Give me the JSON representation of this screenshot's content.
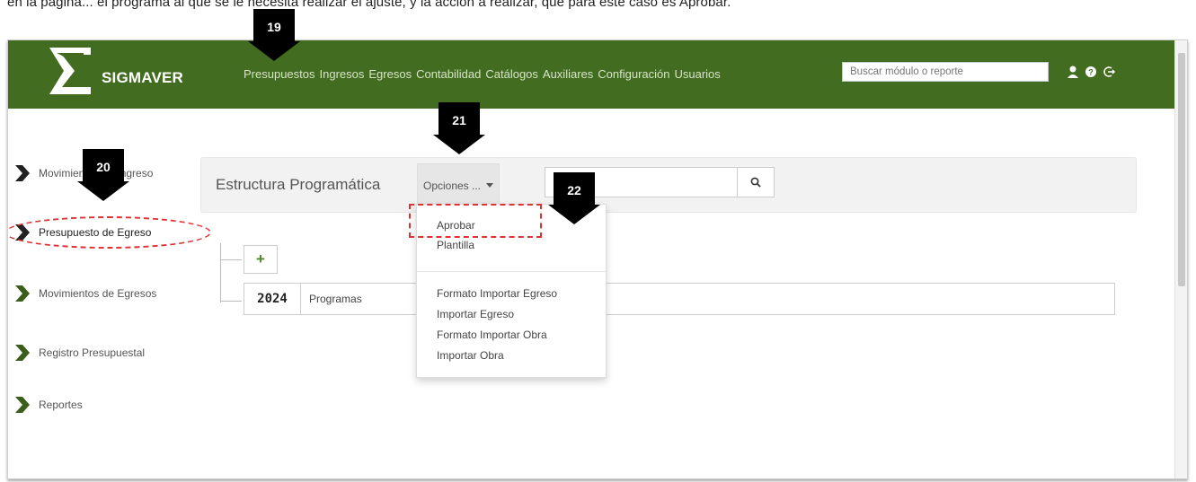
{
  "caption": {
    "text": "en la página... el programa al que se le necesita realizar el ajuste, y la acción a realizar, que para este caso es Aprobar."
  },
  "app": {
    "logo_text": "SIGMAVER"
  },
  "nav": {
    "items": [
      "Presupuestos",
      "Ingresos",
      "Egresos",
      "Contabilidad",
      "Catálogos",
      "Auxiliares",
      "Configuración",
      "Usuarios"
    ],
    "search_placeholder": "Buscar módulo o reporte"
  },
  "sidebar": {
    "items": [
      {
        "label": "Movimientos de Ingreso"
      },
      {
        "label": "Presupuesto de Egreso"
      },
      {
        "label": "Movimientos de Egresos"
      },
      {
        "label": "Registro Presupuestal"
      },
      {
        "label": "Reportes"
      }
    ]
  },
  "toolbar": {
    "title": "Estructura Programática",
    "options_label": "Opciones ..."
  },
  "tree": {
    "add_label": "+",
    "year": "2024",
    "program_label": "Programas"
  },
  "dropdown": {
    "items": [
      "Aprobar",
      "Plantilla",
      "Formato Importar Egreso",
      "Importar Egreso",
      "Formato Importar Obra",
      "Importar Obra"
    ]
  },
  "markers": [
    "19",
    "20",
    "21",
    "22"
  ],
  "colors": {
    "navbar": "#426c1f",
    "highlight": "#d33333",
    "add_icon": "#4b8a22"
  }
}
